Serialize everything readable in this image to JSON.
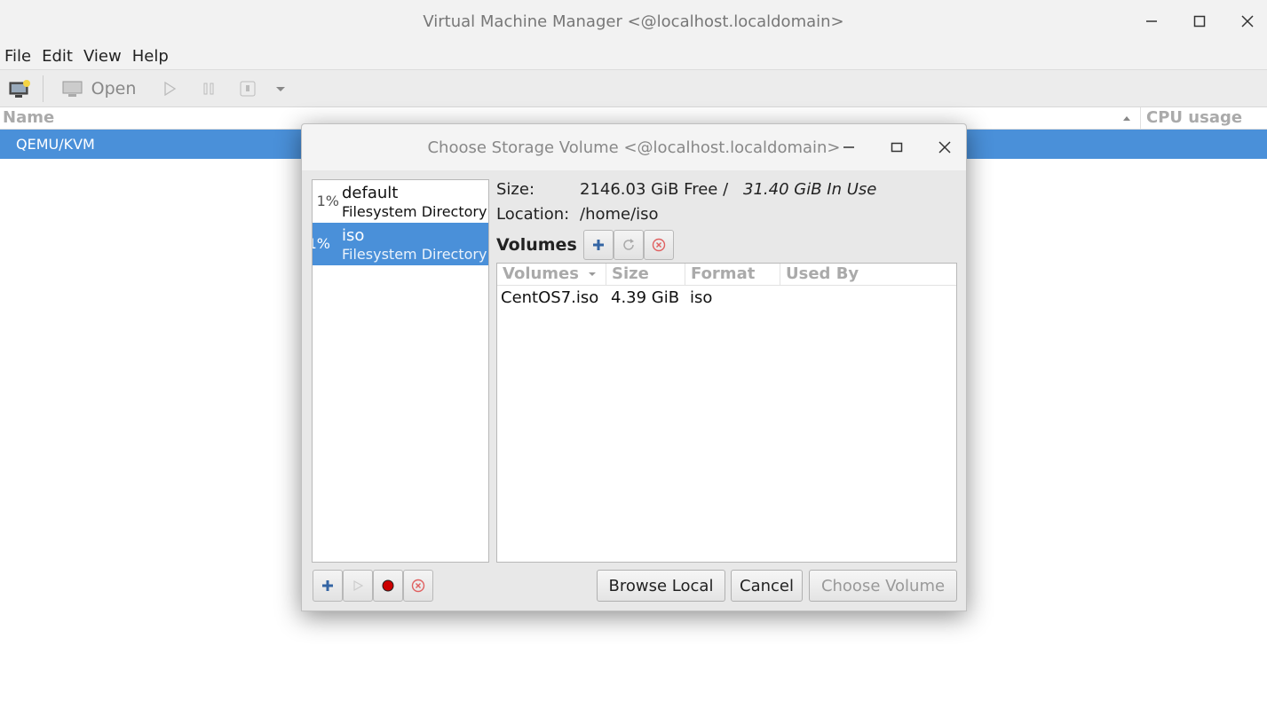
{
  "main_window": {
    "title": "Virtual Machine Manager <@localhost.localdomain>",
    "menu": [
      "File",
      "Edit",
      "View",
      "Help"
    ],
    "toolbar": {
      "open_label": "Open"
    },
    "columns": {
      "name": "Name",
      "cpu_usage": "CPU usage"
    },
    "connection": "QEMU/KVM"
  },
  "dialog": {
    "title": "Choose Storage Volume <@localhost.localdomain>",
    "pools": [
      {
        "pct": "1%",
        "name": "default",
        "type": "Filesystem Directory",
        "selected": false
      },
      {
        "pct": "1%",
        "name": "iso",
        "type": "Filesystem Directory",
        "selected": true
      }
    ],
    "pool_info": {
      "size_label": "Size:",
      "free": "2146.03 GiB Free /",
      "in_use": "31.40 GiB In Use",
      "location_label": "Location:",
      "location": "/home/iso"
    },
    "volumes_label": "Volumes",
    "volume_columns": [
      "Volumes",
      "Size",
      "Format",
      "Used By"
    ],
    "volumes": [
      {
        "name": "CentOS7.iso",
        "size": "4.39 GiB",
        "format": "iso",
        "used_by": ""
      }
    ],
    "buttons": {
      "browse_local": "Browse Local",
      "cancel": "Cancel",
      "choose_volume": "Choose Volume"
    },
    "colors": {
      "selection": "#4a90d9",
      "add": "#3465a4",
      "stop": "#cc0000",
      "delete": "#e06060"
    }
  }
}
